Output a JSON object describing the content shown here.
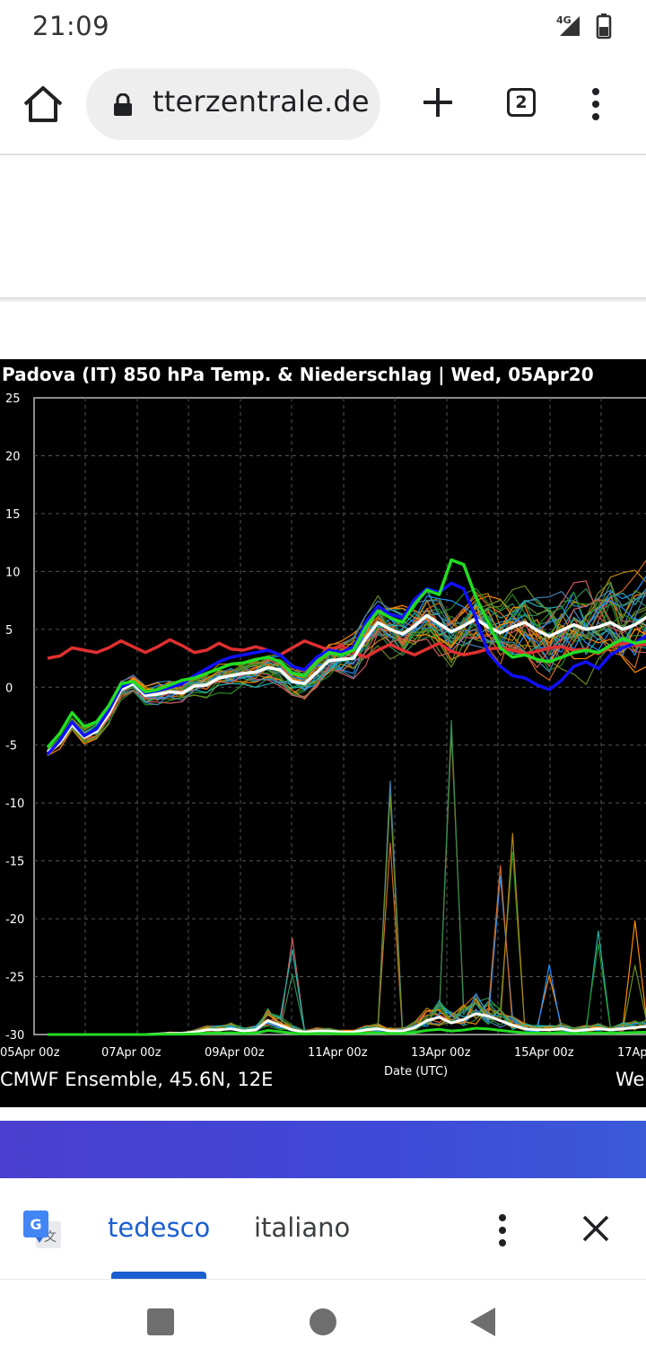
{
  "status_bar": {
    "time": "21:09",
    "network": "4G",
    "icons": [
      "signal-icon",
      "battery-icon"
    ]
  },
  "browser": {
    "url": "tterzentrale.de",
    "tab_count": "2",
    "icons": [
      "home-icon",
      "lock-icon",
      "plus-icon",
      "tabs-icon",
      "more-vert-icon"
    ]
  },
  "chart": {
    "title": "Padova  (IT)  850 hPa Temp. & Niederschlag | Wed, 05Apr20",
    "footer_left": "CMWF Ensemble, 45.6N, 12E",
    "footer_right": "We",
    "x_axis_label": "Date (UTC)",
    "y_tick_labels": [
      "25",
      "20",
      "15",
      "10",
      "5",
      "0",
      "-5",
      "-10",
      "-15",
      "-20",
      "-25",
      "-30"
    ],
    "x_tick_labels": [
      "05Apr 00z",
      "07Apr 00z",
      "09Apr 00z",
      "11Apr 00z",
      "13Apr 00z",
      "15Apr 00z",
      "17Ap"
    ],
    "colors": {
      "background": "#000000",
      "grid": "#555555",
      "mean_line": "#ffffff",
      "climate_line": "#e03030",
      "control_line": "#1010ff",
      "operational_line": "#22dd22",
      "ensemble": [
        "#2e8b57",
        "#d2691e",
        "#b8860b",
        "#1e90ff",
        "#228b22",
        "#ff8c00",
        "#20b2aa",
        "#6b8e23",
        "#cd5c5c",
        "#4682b4"
      ]
    }
  },
  "chart_data": {
    "type": "line",
    "title": "Padova  (IT)  850 hPa Temp. & Niederschlag | Wed, 05Apr20",
    "xlabel": "Date (UTC)",
    "ylabel": "",
    "ylim": [
      -30,
      25
    ],
    "x": [
      0,
      0.25,
      0.5,
      0.75,
      1,
      1.25,
      1.5,
      1.75,
      2,
      2.25,
      2.5,
      2.75,
      3,
      3.25,
      3.5,
      3.75,
      4,
      4.25,
      4.5,
      4.75,
      5,
      5.25,
      5.5,
      5.75,
      6,
      6.25,
      6.5,
      6.75,
      7,
      7.25,
      7.5,
      7.75,
      8,
      8.25,
      8.5,
      8.75,
      9,
      9.25,
      9.5,
      9.75,
      10,
      10.25,
      10.5,
      10.75,
      11,
      11.25,
      11.5,
      11.75,
      12,
      12.25
    ],
    "x_unit": "days after 05Apr 00z",
    "grid": true,
    "series": [
      {
        "name": "",
        "role": "climate",
        "values": [
          2.5,
          2.7,
          3.4,
          3.2,
          3.0,
          3.4,
          4.0,
          3.5,
          3.0,
          3.5,
          4.1,
          3.6,
          3.0,
          3.2,
          3.8,
          3.3,
          3.2,
          3.5,
          3.2,
          2.8,
          3.4,
          4.0,
          3.6,
          3.2,
          3.6,
          3.0,
          2.6,
          3.2,
          3.7,
          3.2,
          2.8,
          3.3,
          3.8,
          3.1,
          2.8,
          3.0,
          3.3,
          3.4,
          3.2,
          2.9,
          3.1,
          3.4,
          3.5,
          3.2,
          3.3,
          2.9,
          3.5,
          3.8,
          3.6,
          3.7
        ]
      },
      {
        "name": "",
        "role": "mean",
        "values": [
          -5.6,
          -4.8,
          -3.2,
          -4.3,
          -3.8,
          -2.3,
          -0.2,
          0.3,
          -0.7,
          -0.6,
          -0.4,
          -0.5,
          0.1,
          0.2,
          0.8,
          1.0,
          1.2,
          1.3,
          1.7,
          1.5,
          0.5,
          0.3,
          1.3,
          2.3,
          2.4,
          2.5,
          4.2,
          5.6,
          5.0,
          4.6,
          5.3,
          6.2,
          5.5,
          4.8,
          5.3,
          5.9,
          5.2,
          4.7,
          5.2,
          5.6,
          4.9,
          4.4,
          4.9,
          5.4,
          5.0,
          5.2,
          5.6,
          5.0,
          5.4,
          6.1
        ]
      },
      {
        "name": "",
        "role": "control",
        "values": [
          -5.8,
          -4.6,
          -3.0,
          -4.2,
          -3.6,
          -2.0,
          0.0,
          0.5,
          -0.5,
          -0.3,
          0.0,
          0.3,
          1.0,
          1.6,
          2.2,
          2.6,
          2.8,
          3.0,
          3.2,
          2.8,
          1.8,
          1.5,
          2.6,
          3.2,
          3.0,
          3.5,
          5.6,
          7.0,
          6.3,
          6.0,
          7.6,
          8.5,
          8.2,
          9.0,
          8.5,
          6.0,
          3.0,
          1.8,
          1.0,
          0.8,
          0.2,
          -0.2,
          0.6,
          1.8,
          2.2,
          1.6,
          2.8,
          3.4,
          3.8,
          4.5
        ]
      },
      {
        "name": "",
        "role": "operational",
        "values": [
          -5.2,
          -4.0,
          -2.2,
          -3.4,
          -3.0,
          -1.6,
          0.3,
          0.5,
          -0.4,
          -0.2,
          0.2,
          0.6,
          0.8,
          1.2,
          1.6,
          2.0,
          2.1,
          2.4,
          2.6,
          2.2,
          1.2,
          1.0,
          2.2,
          3.0,
          2.8,
          3.2,
          5.2,
          6.6,
          6.0,
          5.6,
          7.2,
          8.4,
          8.0,
          11.0,
          10.6,
          7.8,
          5.6,
          3.4,
          2.6,
          2.8,
          2.4,
          2.2,
          2.6,
          3.0,
          3.2,
          3.0,
          3.6,
          4.2,
          3.8,
          4.0
        ]
      }
    ],
    "precip_mean_values": [
      0,
      0,
      0,
      0,
      0,
      0,
      0,
      0,
      0,
      0.05,
      0.1,
      0.1,
      0.2,
      0.4,
      0.4,
      0.5,
      0.3,
      0.4,
      1.2,
      0.8,
      0.4,
      0.2,
      0.3,
      0.3,
      0.2,
      0.2,
      0.4,
      0.5,
      0.3,
      0.3,
      0.6,
      1.2,
      1.5,
      1.0,
      1.3,
      1.8,
      1.6,
      1.2,
      0.8,
      0.5,
      0.4,
      0.4,
      0.5,
      0.3,
      0.4,
      0.5,
      0.4,
      0.5,
      0.6,
      0.7
    ]
  },
  "translate_bar": {
    "source_lang": "tedesco",
    "target_lang": "italiano",
    "icons": [
      "google-translate-icon",
      "more-vert-icon",
      "close-icon"
    ]
  },
  "nav_bar": {
    "icons": [
      "recents-icon",
      "home-circle-icon",
      "back-icon"
    ]
  }
}
